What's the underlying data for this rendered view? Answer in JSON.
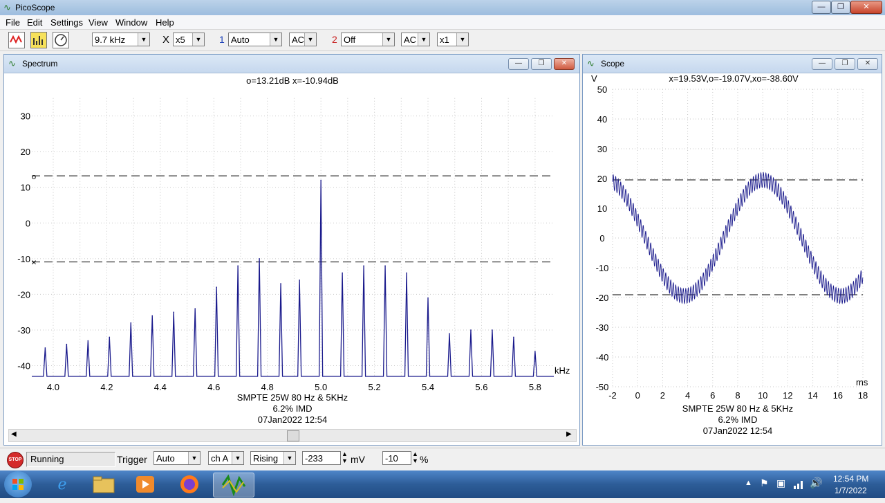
{
  "app": {
    "title": "PicoScope",
    "window_buttons": {
      "minimize": "—",
      "restore": "❐",
      "close": "✕"
    }
  },
  "menu": [
    "File",
    "Edit",
    "Settings",
    "View",
    "Window",
    "Help"
  ],
  "toolbar": {
    "timebase": "9.7 kHz",
    "x_label": "X",
    "zoom": "x5",
    "ch1_label": "1",
    "ch1_range": "Auto",
    "ch1_coupling": "AC",
    "ch2_label": "2",
    "ch2_range": "Off",
    "ch2_coupling": "AC",
    "multiplier": "x1"
  },
  "spectrum": {
    "title": "Spectrum",
    "readout": "o=13.21dB  x=-10.94dB",
    "caption": [
      "SMPTE 25W 80 Hz & 5KHz",
      "6.2% IMD",
      "07Jan2022  12:54"
    ],
    "o_marker": "o",
    "x_marker": "×",
    "chart_data": {
      "type": "line",
      "xlabel": "kHz",
      "ylabel": "",
      "xlim": [
        3.92,
        5.87
      ],
      "ylim": [
        -43,
        40
      ],
      "x_ticks": [
        "4.0",
        "4.2",
        "4.4",
        "4.6",
        "4.8",
        "5.0",
        "5.2",
        "5.4",
        "5.6",
        "5.8"
      ],
      "y_ticks": [
        "30",
        "20",
        "10",
        "0",
        "-10",
        "-20",
        "-30",
        "-40"
      ],
      "cursors_db": {
        "o": 13.21,
        "x": -10.94
      },
      "peaks_khz": [
        3.97,
        4.05,
        4.13,
        4.21,
        4.29,
        4.37,
        4.45,
        4.53,
        4.61,
        4.69,
        4.77,
        4.85,
        4.92,
        5.0,
        5.08,
        5.16,
        5.24,
        5.32,
        5.4,
        5.48,
        5.56,
        5.64,
        5.72,
        5.8
      ],
      "peaks_db": [
        -35,
        -34,
        -33,
        -32,
        -28,
        -26,
        -25,
        -24,
        -18,
        -12,
        -10,
        -17,
        -16,
        12,
        -14,
        -12,
        -12,
        -14,
        -21,
        -31,
        -30,
        -30,
        -32,
        -36
      ],
      "floor_db": -43
    }
  },
  "scope": {
    "title": "Scope",
    "readout": "x=19.53V,o=-19.07V,xo=-38.60V",
    "caption": [
      "SMPTE 25W 80 Hz & 5KHz",
      "6.2% IMD",
      "07Jan2022  12:54"
    ],
    "chart_data": {
      "type": "line",
      "xlabel": "ms",
      "ylabel": "V",
      "xlim": [
        -2,
        18
      ],
      "ylim": [
        -50,
        50
      ],
      "x_ticks": [
        "-2",
        "0",
        "2",
        "4",
        "6",
        "8",
        "10",
        "12",
        "14",
        "16",
        "18"
      ],
      "y_ticks": [
        "50",
        "40",
        "30",
        "20",
        "10",
        "0",
        "-10",
        "-20",
        "-30",
        "-40",
        "-50"
      ],
      "cursors_v": {
        "x": 19.53,
        "o": -19.07
      },
      "carrier_hz": 80,
      "carrier_amplitude_v": 19.5,
      "carrier_peak_ms": 10,
      "signal_x_range_ms": [
        -2,
        18
      ],
      "imd_tone_hz": 5000,
      "imd_amplitude_v": 2.5
    }
  },
  "status": {
    "stop_label": "STOP",
    "state": "Running",
    "trigger_label": "Trigger",
    "trigger_mode": "Auto",
    "trigger_channel": "ch A",
    "trigger_edge": "Rising",
    "trigger_level": "-233",
    "level_unit": "mV",
    "pretrigger": "-10",
    "pretrigger_unit": "%"
  },
  "taskbar": {
    "time": "12:54 PM",
    "date": "1/7/2022"
  },
  "colors": {
    "trace": "#1a1a8c",
    "titlebar": "#a9c5e2",
    "taskbar": "#2d5d98"
  }
}
